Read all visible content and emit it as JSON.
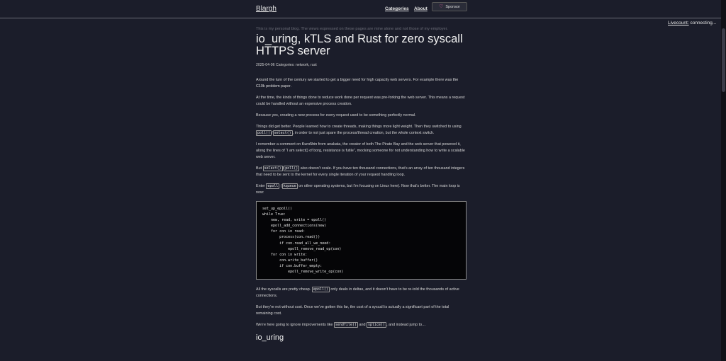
{
  "header": {
    "logo": "Blargh",
    "nav": [
      {
        "label": "Categories"
      },
      {
        "label": "About"
      }
    ],
    "sponsor_label": "Sponsor"
  },
  "livecount": {
    "label": "Livecount:",
    "status": "connecting..."
  },
  "article": {
    "disclaimer": "This is my personal blog. The views expressed on these pages are mine alone and not those of my employer.",
    "title": "io_uring, kTLS and Rust for zero syscall HTTPS server",
    "date": "2025-04-06",
    "categories_label": "Categories:",
    "categories": "network, rust",
    "p1": {
      "a": "Around the turn of the century we started to get a bigger need for high capacity web servers. For example there was ",
      "link": "the C10k problem",
      "b": " paper."
    },
    "p2": "At the time, the kinds of things done to reduce work done per request was pre-forking the web server. This means a request could be handled without an expensive process creation.",
    "p3": "Because yes, creating a new process for every request used to be something perfectly normal.",
    "p4": {
      "a": "Things did get better. People learned how to create threads, making things more light weight. Then they switched to using ",
      "code1": "poll()",
      "sep": "/",
      "code2": "select()",
      "b": ", in order to not just spare the process/thread creation, but the whole context switch."
    },
    "p5": {
      "a": "I remember a comment on ",
      "link": "Kuro5hin",
      "b": " from anakata, the creator of both The Pirate Bay and the web server that powered it, along the lines of “I am select() of borg, resistance is futile”, mocking someone for not understanding how to write a scalable web server."
    },
    "p6": {
      "a": "But ",
      "code1": "select()",
      "sep": "/",
      "code2": "poll()",
      "b": " also doesn’t scale. If you have ten thousand connections, that’s an array of ten thousand integers that need to be sent to the kernel for every single iteration of your request handling loop."
    },
    "p7": {
      "a": "Enter ",
      "code1": "epoll",
      "sep": " (",
      "code2": "kqueue",
      "b": " on other operating systems, but I’m focusing on Linux here). Now that’s better. The main loop is now:"
    },
    "code": "set_up_epoll()\nwhile True:\n    new, read, write = epoll()\n    epoll_add_connections(new)\n    for con in read:\n        process(con.read())\n        if con.read_all_we_need:\n            epoll_remove_read_op(con)\n    for con in write:\n        con.write_buffer()\n        if con.buffer_empty:\n            epoll_remove_write_op(con)",
    "p8": {
      "a": "All the syscalls are pretty cheap. ",
      "code1": "epoll()",
      "b": " only deals in deltas, and it doesn’t have to be re-told the thousands of active connections."
    },
    "p9": "But they’re not without cost. Once we’ve gotten this far, the cost of a syscall is actually a significant part of the total remaining cost.",
    "p10": {
      "a": "We’re here going to ignore improvements like ",
      "code1": "sendfile()",
      "sep": " and ",
      "code2": "splice()",
      "b": ", and instead jump to…"
    },
    "h2": "io_uring"
  },
  "colors": {
    "background": "#1b1d2a",
    "text": "#d9d9d9",
    "code_bg": "#050507",
    "heart": "#db61a2"
  },
  "icons": {
    "sponsor": "heart-icon"
  }
}
